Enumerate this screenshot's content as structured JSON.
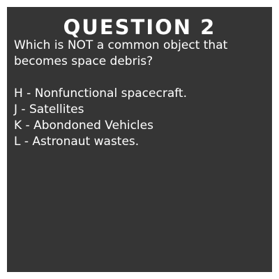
{
  "card": {
    "background_color": "#353535",
    "text_color": "#ffffff",
    "title": "QUESTION 2",
    "question": "Which is NOT a common object that becomes space debris?",
    "answers": [
      "H - Nonfunctional spacecraft.",
      "J - Satellites",
      "K - Abondoned Vehicles",
      "L - Astronaut wastes."
    ]
  }
}
